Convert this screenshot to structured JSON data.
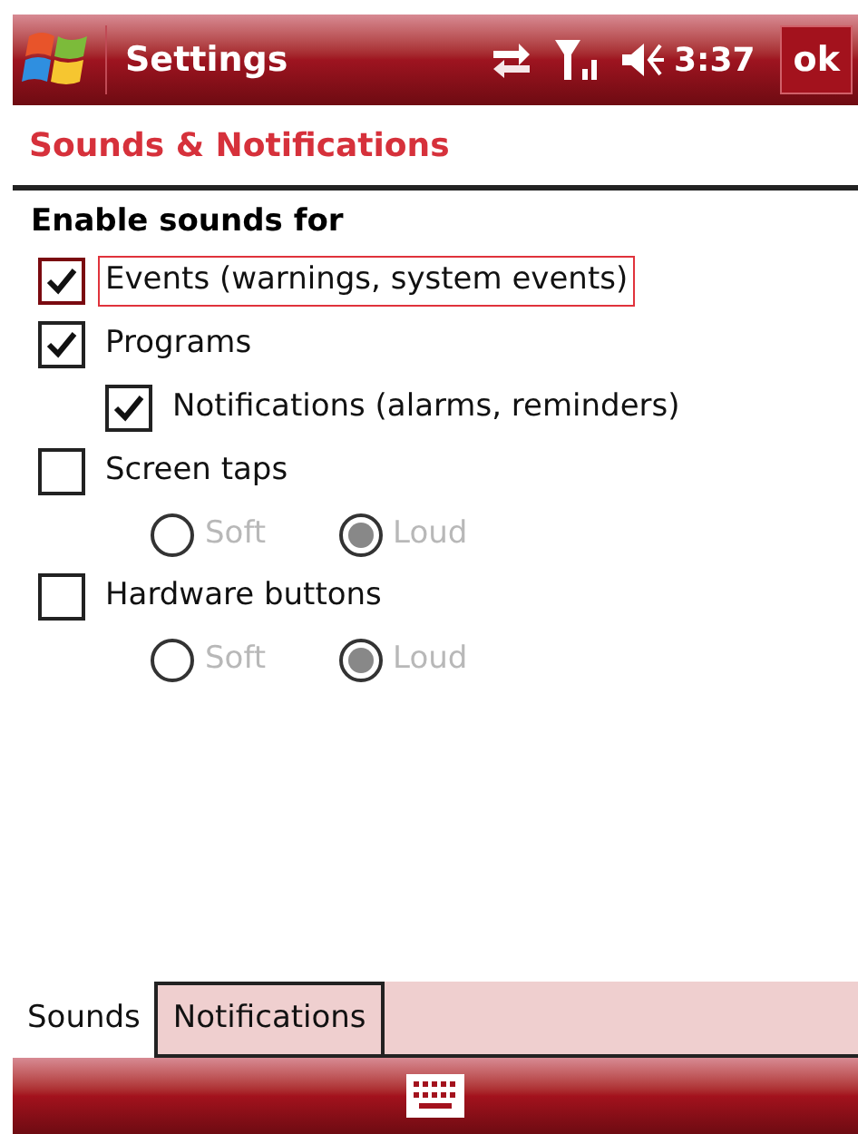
{
  "title_bar": {
    "title": "Settings",
    "time": "3:37",
    "ok": "ok"
  },
  "header": "Sounds & Notifications",
  "section": "Enable sounds for",
  "options": [
    {
      "kind": "checkbox",
      "label": "Events (warnings, system events)",
      "checked": true,
      "focused": true
    },
    {
      "kind": "checkbox",
      "label": "Programs",
      "checked": true,
      "focused": false,
      "children": [
        {
          "kind": "checkbox",
          "label": "Notifications (alarms, reminders)",
          "checked": true,
          "focused": false
        }
      ]
    },
    {
      "kind": "checkbox",
      "label": "Screen taps",
      "checked": false,
      "focused": false,
      "children": [
        {
          "kind": "radios",
          "items": [
            {
              "label": "Soft",
              "selected": false,
              "disabled": true
            },
            {
              "label": "Loud",
              "selected": true,
              "disabled": true
            }
          ]
        }
      ]
    },
    {
      "kind": "checkbox",
      "label": "Hardware buttons",
      "checked": false,
      "focused": false,
      "children": [
        {
          "kind": "radios",
          "items": [
            {
              "label": "Soft",
              "selected": false,
              "disabled": true
            },
            {
              "label": "Loud",
              "selected": true,
              "disabled": true
            }
          ]
        }
      ]
    }
  ],
  "tabs": [
    {
      "label": "Sounds",
      "selected": true
    },
    {
      "label": "Notifications",
      "selected": false
    }
  ]
}
